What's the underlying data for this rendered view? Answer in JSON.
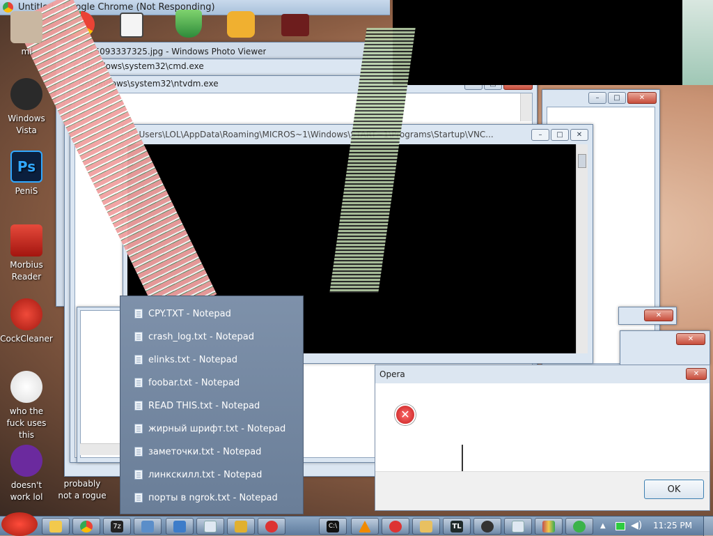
{
  "chrome_window": {
    "title": "Untitled - Google Chrome (Not Responding)"
  },
  "stacked_windows": [
    {
      "title": "20615093337325.jpg - Windows Photo Viewer"
    },
    {
      "title": "C:\\Windows\\system32\\cmd.exe"
    },
    {
      "title": "C:\\Windows\\system32\\ntvdm.exe"
    },
    {
      "title": "C:\\Users\\LOL\\AppData\\Roaming\\MICROS~1\\Windows\\START~1\\Programs\\Startup\\VNC..."
    }
  ],
  "desktop_icons": [
    {
      "label": "mi",
      "icon": "app-icon"
    },
    {
      "label": "Windows Vista",
      "icon": "windows-vista-icon"
    },
    {
      "label": "PeniS",
      "icon": "photoshop-icon"
    },
    {
      "label": "Morbius Reader",
      "icon": "pdf-reader-icon"
    },
    {
      "label": "CockCleaner",
      "icon": "ccleaner-icon"
    },
    {
      "label": "who the fuck uses this",
      "icon": "lightning-icon"
    },
    {
      "label": "doesn't work lol",
      "icon": "yahoo-messenger-icon"
    },
    {
      "label": "probably not a rogue",
      "icon": "antivirus-icon"
    }
  ],
  "jumplist": {
    "items": [
      "CPY.TXT - Notepad",
      "crash_log.txt - Notepad",
      "elinks.txt - Notepad",
      "foobar.txt - Notepad",
      "READ THIS.txt - Notepad",
      "жирный шрифт.txt - Notepad",
      "заметочки.txt - Notepad",
      "линкскилл.txt - Notepad",
      "порты в ngrok.txt - Notepad"
    ]
  },
  "opera_dialog": {
    "title": "Opera",
    "ok_label": "OK",
    "icon": "error-icon"
  },
  "taskbar": {
    "clock": "11:25 PM",
    "buttons": [
      {
        "icon": "explorer-icon",
        "color": "#f2c94c"
      },
      {
        "icon": "chrome-icon",
        "color": "#34a853"
      },
      {
        "icon": "7zip-icon",
        "color": "#222222"
      },
      {
        "icon": "photo-viewer-icon",
        "color": "#5b8ec9"
      },
      {
        "icon": "network-icon",
        "color": "#3d7cc9"
      },
      {
        "icon": "notepad-icon",
        "color": "#dfe8f2"
      },
      {
        "icon": "antivirus-icon",
        "color": "#e0b030"
      },
      {
        "icon": "error-icon",
        "color": "#d33"
      },
      {
        "icon": "cmd-icon",
        "color": "#111111"
      },
      {
        "icon": "vlc-icon",
        "color": "#f08a00"
      },
      {
        "icon": "error-icon",
        "color": "#d33"
      },
      {
        "icon": "folder-icon",
        "color": "#e8c060"
      },
      {
        "icon": "tl-icon",
        "color": "#1f2a2a"
      },
      {
        "icon": "eye-icon",
        "color": "#333333"
      },
      {
        "icon": "notepad-icon",
        "color": "#dfe8f2"
      },
      {
        "icon": "paint-icon",
        "color": "#c0504d"
      },
      {
        "icon": "utorrent-icon",
        "color": "#3bb34a"
      }
    ],
    "tb_labels": {
      "7zip": "7z",
      "tl": "TL",
      "cmd": "C:\\"
    }
  },
  "top_icons": [
    {
      "icon": "chrome-icon"
    },
    {
      "icon": "card-icon"
    },
    {
      "icon": "shield-check-icon"
    },
    {
      "icon": "angry-birds-pig-icon"
    },
    {
      "icon": "red-shield-icon"
    }
  ],
  "colors": {
    "taskbar": "#6c88a9",
    "jumplist": "#75899f",
    "error_red": "#d33333"
  }
}
